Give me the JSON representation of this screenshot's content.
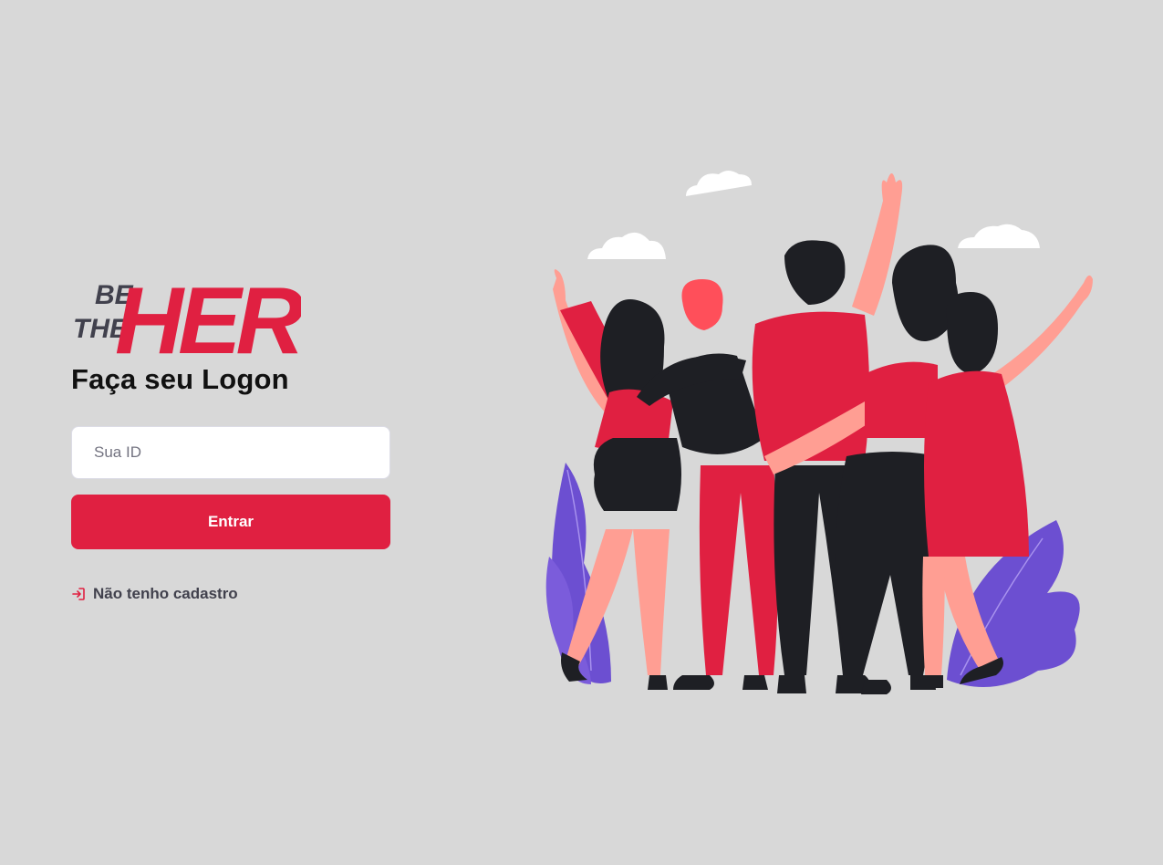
{
  "logo": {
    "line1": "BE",
    "line2": "THE",
    "word": "HERO"
  },
  "login": {
    "title": "Faça seu Logon",
    "id_placeholder": "Sua ID",
    "id_value": "",
    "submit_label": "Entrar",
    "register_link": "Não tenho cadastro"
  },
  "colors": {
    "background": "#d8d8d8",
    "accent": "#e02041",
    "text_dark": "#41414d",
    "logo_gray": "#41414d"
  },
  "icons": {
    "register_link_icon": "log-in-icon"
  }
}
